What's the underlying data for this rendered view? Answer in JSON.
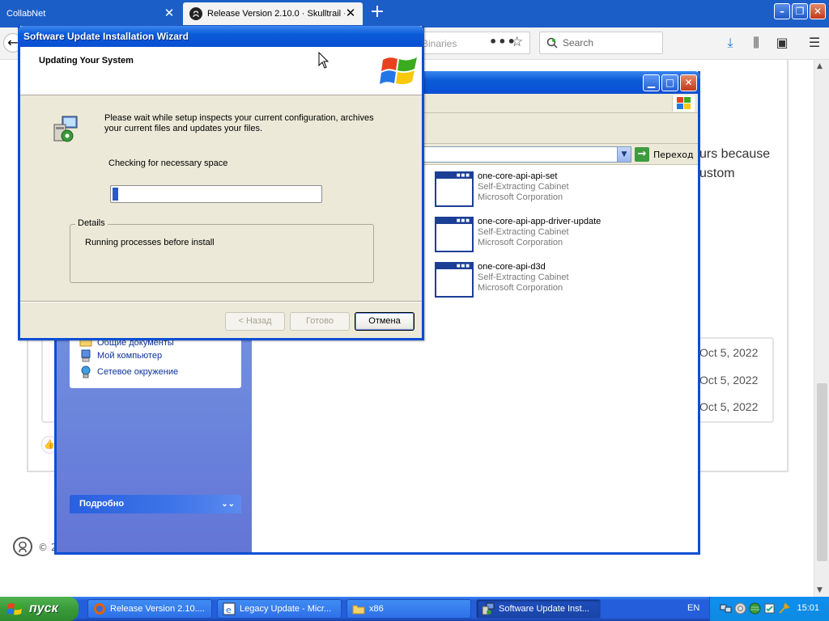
{
  "browser": {
    "tabs": [
      {
        "label": "CollabNet",
        "active": false
      },
      {
        "label": "Release Version 2.10.0 · Skulltrail ·",
        "active": true
      }
    ],
    "url_partial": "Binaries",
    "search_placeholder": "Search"
  },
  "web_page": {
    "snippet_line1": "urs because",
    "snippet_line2": "ustom",
    "dates": [
      "Oct 5, 2022",
      "Oct 5, 2022",
      "Oct 5, 2022"
    ],
    "copyright": "© 2"
  },
  "explorer": {
    "address_go_label": "Переход",
    "left_panel_items": [
      {
        "label": "Общие документы",
        "icon": "folder-icon"
      },
      {
        "label": "Мой компьютер",
        "icon": "computer-icon"
      },
      {
        "label": "Сетевое окружение",
        "icon": "network-icon"
      }
    ],
    "details_panel_label": "Подробно",
    "files": [
      {
        "name": "one-core-api-api-set",
        "type": "Self-Extracting Cabinet",
        "company": "Microsoft Corporation"
      },
      {
        "name": "one-core-api-app-driver-update",
        "type": "Self-Extracting Cabinet",
        "company": "Microsoft Corporation"
      },
      {
        "name": "one-core-api-d3d",
        "type": "Self-Extracting Cabinet",
        "company": "Microsoft Corporation"
      }
    ]
  },
  "wizard": {
    "title": "Software Update Installation Wizard",
    "header_title": "Updating Your System",
    "description": "Please wait while setup inspects your current configuration, archives your current files and updates your files.",
    "status_text": "Checking for necessary space",
    "progress_fraction": 0.03,
    "details_label": "Details",
    "details_text": "Running processes before install",
    "buttons": {
      "back": "< Назад",
      "finish": "Готово",
      "cancel": "Отмена"
    }
  },
  "taskbar": {
    "start_label": "пуск",
    "tasks": [
      {
        "label": "Release Version 2.10....",
        "icon": "firefox-icon",
        "active": false
      },
      {
        "label": "Legacy Update - Micr...",
        "icon": "ie-icon",
        "active": false
      },
      {
        "label": "x86",
        "icon": "folder-icon",
        "active": false
      },
      {
        "label": "Software Update Inst...",
        "icon": "setup-icon",
        "active": true
      }
    ],
    "language": "EN",
    "clock": "15:01"
  },
  "colors": {
    "xp_title_blue": "#0a4fd4",
    "taskbar_blue": "#245edb",
    "start_green": "#3a9a3a",
    "firefox_tabbar": "#1c5ec7"
  }
}
